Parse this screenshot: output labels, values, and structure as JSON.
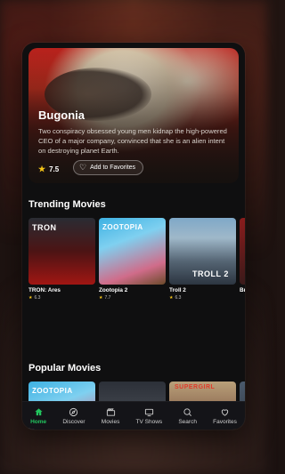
{
  "hero": {
    "title": "Bugonia",
    "description": "Two conspiracy obsessed young men kidnap the high-powered CEO of a major company, convinced that she is an alien intent on destroying planet Earth.",
    "rating": "7.5",
    "favorite_label": "Add to Favorites"
  },
  "trending": {
    "title": "Trending Movies",
    "movies": [
      {
        "title": "TRON: Ares",
        "rating": "6.3",
        "poster_text": "TRON"
      },
      {
        "title": "Zootopia 2",
        "rating": "7.7",
        "poster_text": "ZOOTOPIA"
      },
      {
        "title": "Troll 2",
        "rating": "6.3",
        "poster_text": "TROLL 2"
      },
      {
        "title": "Br",
        "rating": "",
        "poster_text": ""
      }
    ]
  },
  "popular": {
    "title": "Popular Movies",
    "poster_texts": [
      "ZOOTOPIA",
      "",
      "SUPERGIRL",
      ""
    ]
  },
  "nav": {
    "items": [
      {
        "label": "Home",
        "icon": "home-icon",
        "active": true
      },
      {
        "label": "Discover",
        "icon": "compass-icon",
        "active": false
      },
      {
        "label": "Movies",
        "icon": "clapperboard-icon",
        "active": false
      },
      {
        "label": "TV Shows",
        "icon": "tv-icon",
        "active": false
      },
      {
        "label": "Search",
        "icon": "search-icon",
        "active": false
      },
      {
        "label": "Favorites",
        "icon": "heart-icon",
        "active": false
      }
    ]
  },
  "colors": {
    "accent": "#22c55e",
    "star": "#f5c518",
    "background": "#0f0f10"
  }
}
